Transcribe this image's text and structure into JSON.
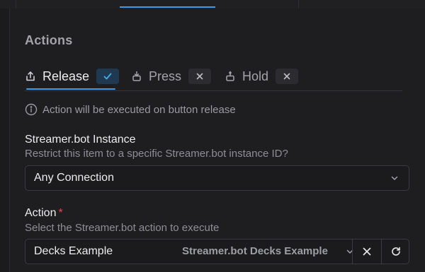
{
  "actions": {
    "title": "Actions",
    "tabs": [
      {
        "label": "Release",
        "status": "enabled",
        "icon": "release-icon"
      },
      {
        "label": "Press",
        "status": "disabled",
        "icon": "press-icon"
      },
      {
        "label": "Hold",
        "status": "disabled",
        "icon": "hold-icon"
      }
    ],
    "info": "Action will be executed on button release"
  },
  "instance": {
    "label": "Streamer.bot Instance",
    "help": "Restrict this item to a specific Streamer.bot instance ID?",
    "value": "Any Connection"
  },
  "action": {
    "label": "Action",
    "required_mark": "*",
    "help": "Select the Streamer.bot action to execute",
    "value": "Decks Example",
    "hint": "Streamer.bot Decks Example"
  },
  "colors": {
    "accent": "#3b9be8",
    "background": "#1e1e21",
    "required": "#e5484d"
  }
}
